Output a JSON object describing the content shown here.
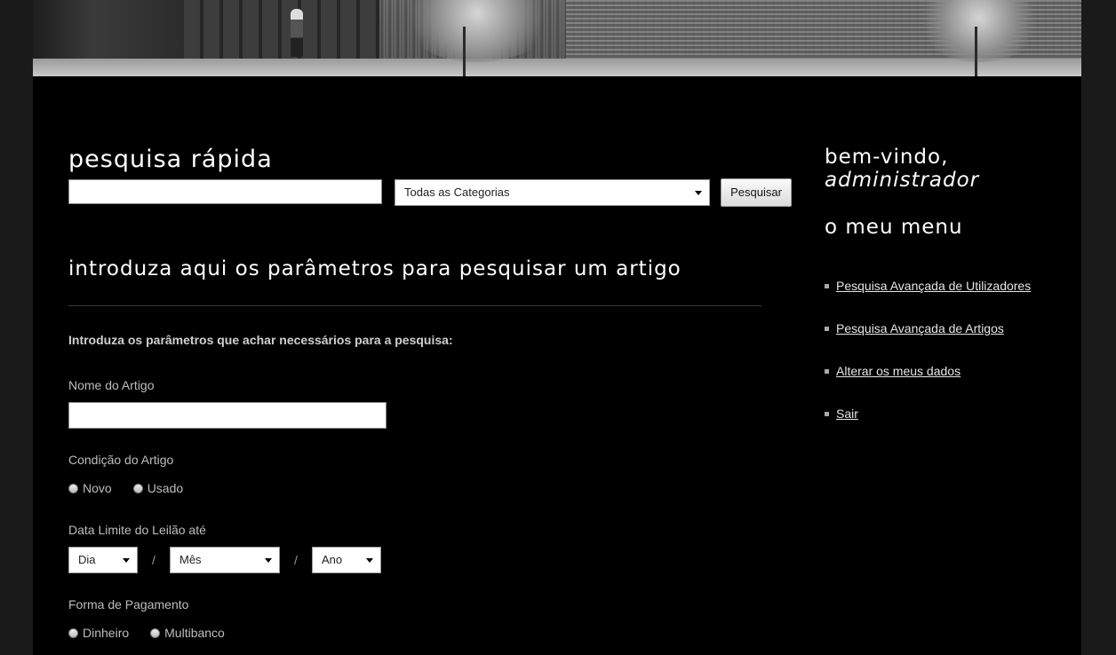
{
  "quick_search": {
    "title": "pesquisa rápida",
    "query_value": "",
    "category_selected": "Todas as Categorias",
    "button_label": "Pesquisar"
  },
  "article_search": {
    "title": "introduza aqui os parâmetros para pesquisar um artigo",
    "intro": "Introduza os parâmetros que achar necessários para a pesquisa:",
    "name_label": "Nome do Artigo",
    "name_value": "",
    "condition_label": "Condição do Artigo",
    "condition_options": [
      "Novo",
      "Usado"
    ],
    "deadline_label": "Data Limite do Leilão até",
    "day_selected": "Dia",
    "month_selected": "Mês",
    "year_selected": "Ano",
    "date_separator": "/",
    "payment_label": "Forma de Pagamento",
    "payment_options": [
      "Dinheiro",
      "Multibanco"
    ]
  },
  "sidebar": {
    "welcome": "bem-vindo,",
    "username": "administrador",
    "menu_title": "o meu menu",
    "items": [
      {
        "label": "Pesquisa Avançada de Utilizadores"
      },
      {
        "label": "Pesquisa Avançada de Artigos"
      },
      {
        "label": "Alterar os meus dados"
      },
      {
        "label": "Sair"
      }
    ]
  },
  "colors": {
    "page_background": "#000000",
    "outer_background": "#1a1a1a",
    "heading": "#ffffff",
    "text": "#bdbdbd"
  }
}
